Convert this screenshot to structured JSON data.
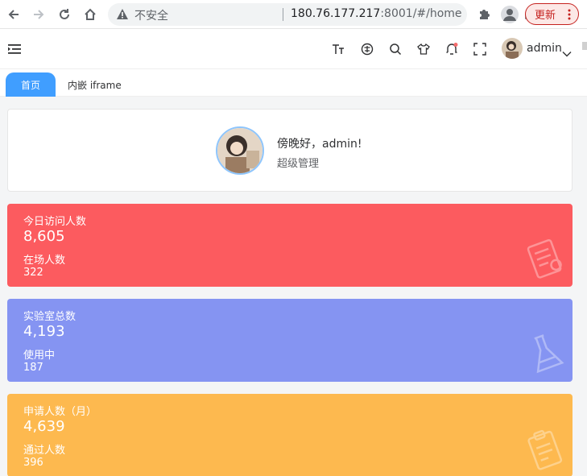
{
  "browser": {
    "insecure_label": "不安全",
    "url_host": "180.76.177.217",
    "url_rest": ":8001/#/home",
    "update_label": "更新"
  },
  "header": {
    "username": "admin"
  },
  "tabs": [
    {
      "label": "首页"
    },
    {
      "label": "内嵌 iframe"
    }
  ],
  "welcome": {
    "greeting": "傍晚好，admin!",
    "role": "超级管理"
  },
  "stats": [
    {
      "title": "今日访问人数",
      "value": "8,605",
      "sub_title": "在场人数",
      "sub_value": "322",
      "color": "#fc5b5f",
      "icon": "clipboard-icon"
    },
    {
      "title": "实验室总数",
      "value": "4,193",
      "sub_title": "使用中",
      "sub_value": "187",
      "color": "#8594f2",
      "icon": "flask-icon"
    },
    {
      "title": "申请人数（月）",
      "value": "4,639",
      "sub_title": "通过人数",
      "sub_value": "396",
      "color": "#fdb94f",
      "icon": "form-icon"
    }
  ]
}
